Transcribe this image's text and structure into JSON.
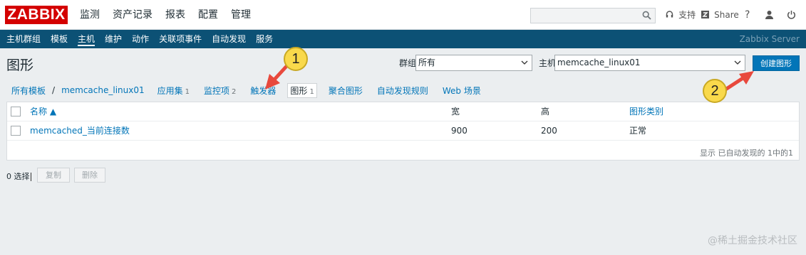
{
  "brand": {
    "logo_text": "ZABBIX",
    "color": "#d40000"
  },
  "topnav": {
    "items": [
      "监测",
      "资产记录",
      "报表",
      "配置",
      "管理"
    ],
    "support_label": "支持",
    "share_label": "Share",
    "help_glyph": "?",
    "search_value": ""
  },
  "subnav": {
    "items": [
      "主机群组",
      "模板",
      "主机",
      "维护",
      "动作",
      "关联项事件",
      "自动发现",
      "服务"
    ],
    "active": "主机",
    "server_name": "Zabbix Server",
    "bg_color": "#0c5175"
  },
  "page": {
    "title": "图形",
    "group_label": "群组",
    "group_value": "所有",
    "host_label": "主机",
    "host_value": "memcache_linux01",
    "create_button": "创建图形"
  },
  "breadcrumb": {
    "all_templates": "所有模板",
    "separator": "/",
    "host": "memcache_linux01"
  },
  "tabs": [
    {
      "label": "应用集",
      "count": "1"
    },
    {
      "label": "监控项",
      "count": "2"
    },
    {
      "label": "触发器",
      "count": ""
    },
    {
      "label": "图形",
      "count": "1",
      "active": true
    },
    {
      "label": "聚合图形",
      "count": ""
    },
    {
      "label": "自动发现规则",
      "count": ""
    },
    {
      "label": "Web 场景",
      "count": ""
    }
  ],
  "table": {
    "columns": [
      "名称 ▲",
      "宽",
      "高",
      "图形类别"
    ],
    "rows": [
      {
        "name": "memcached_当前连接数",
        "width": "900",
        "height": "200",
        "type": "正常"
      }
    ],
    "footer": "显示 已自动发现的 1中的1"
  },
  "actions": {
    "selected": "0 选择",
    "copy_button": "复制",
    "delete_button": "删除"
  },
  "annotations": {
    "callout_1": "1",
    "callout_2": "2",
    "arrow_color": "#e8493d",
    "callout_color": "#f9d94b"
  },
  "watermark": "@稀土掘金技术社区"
}
